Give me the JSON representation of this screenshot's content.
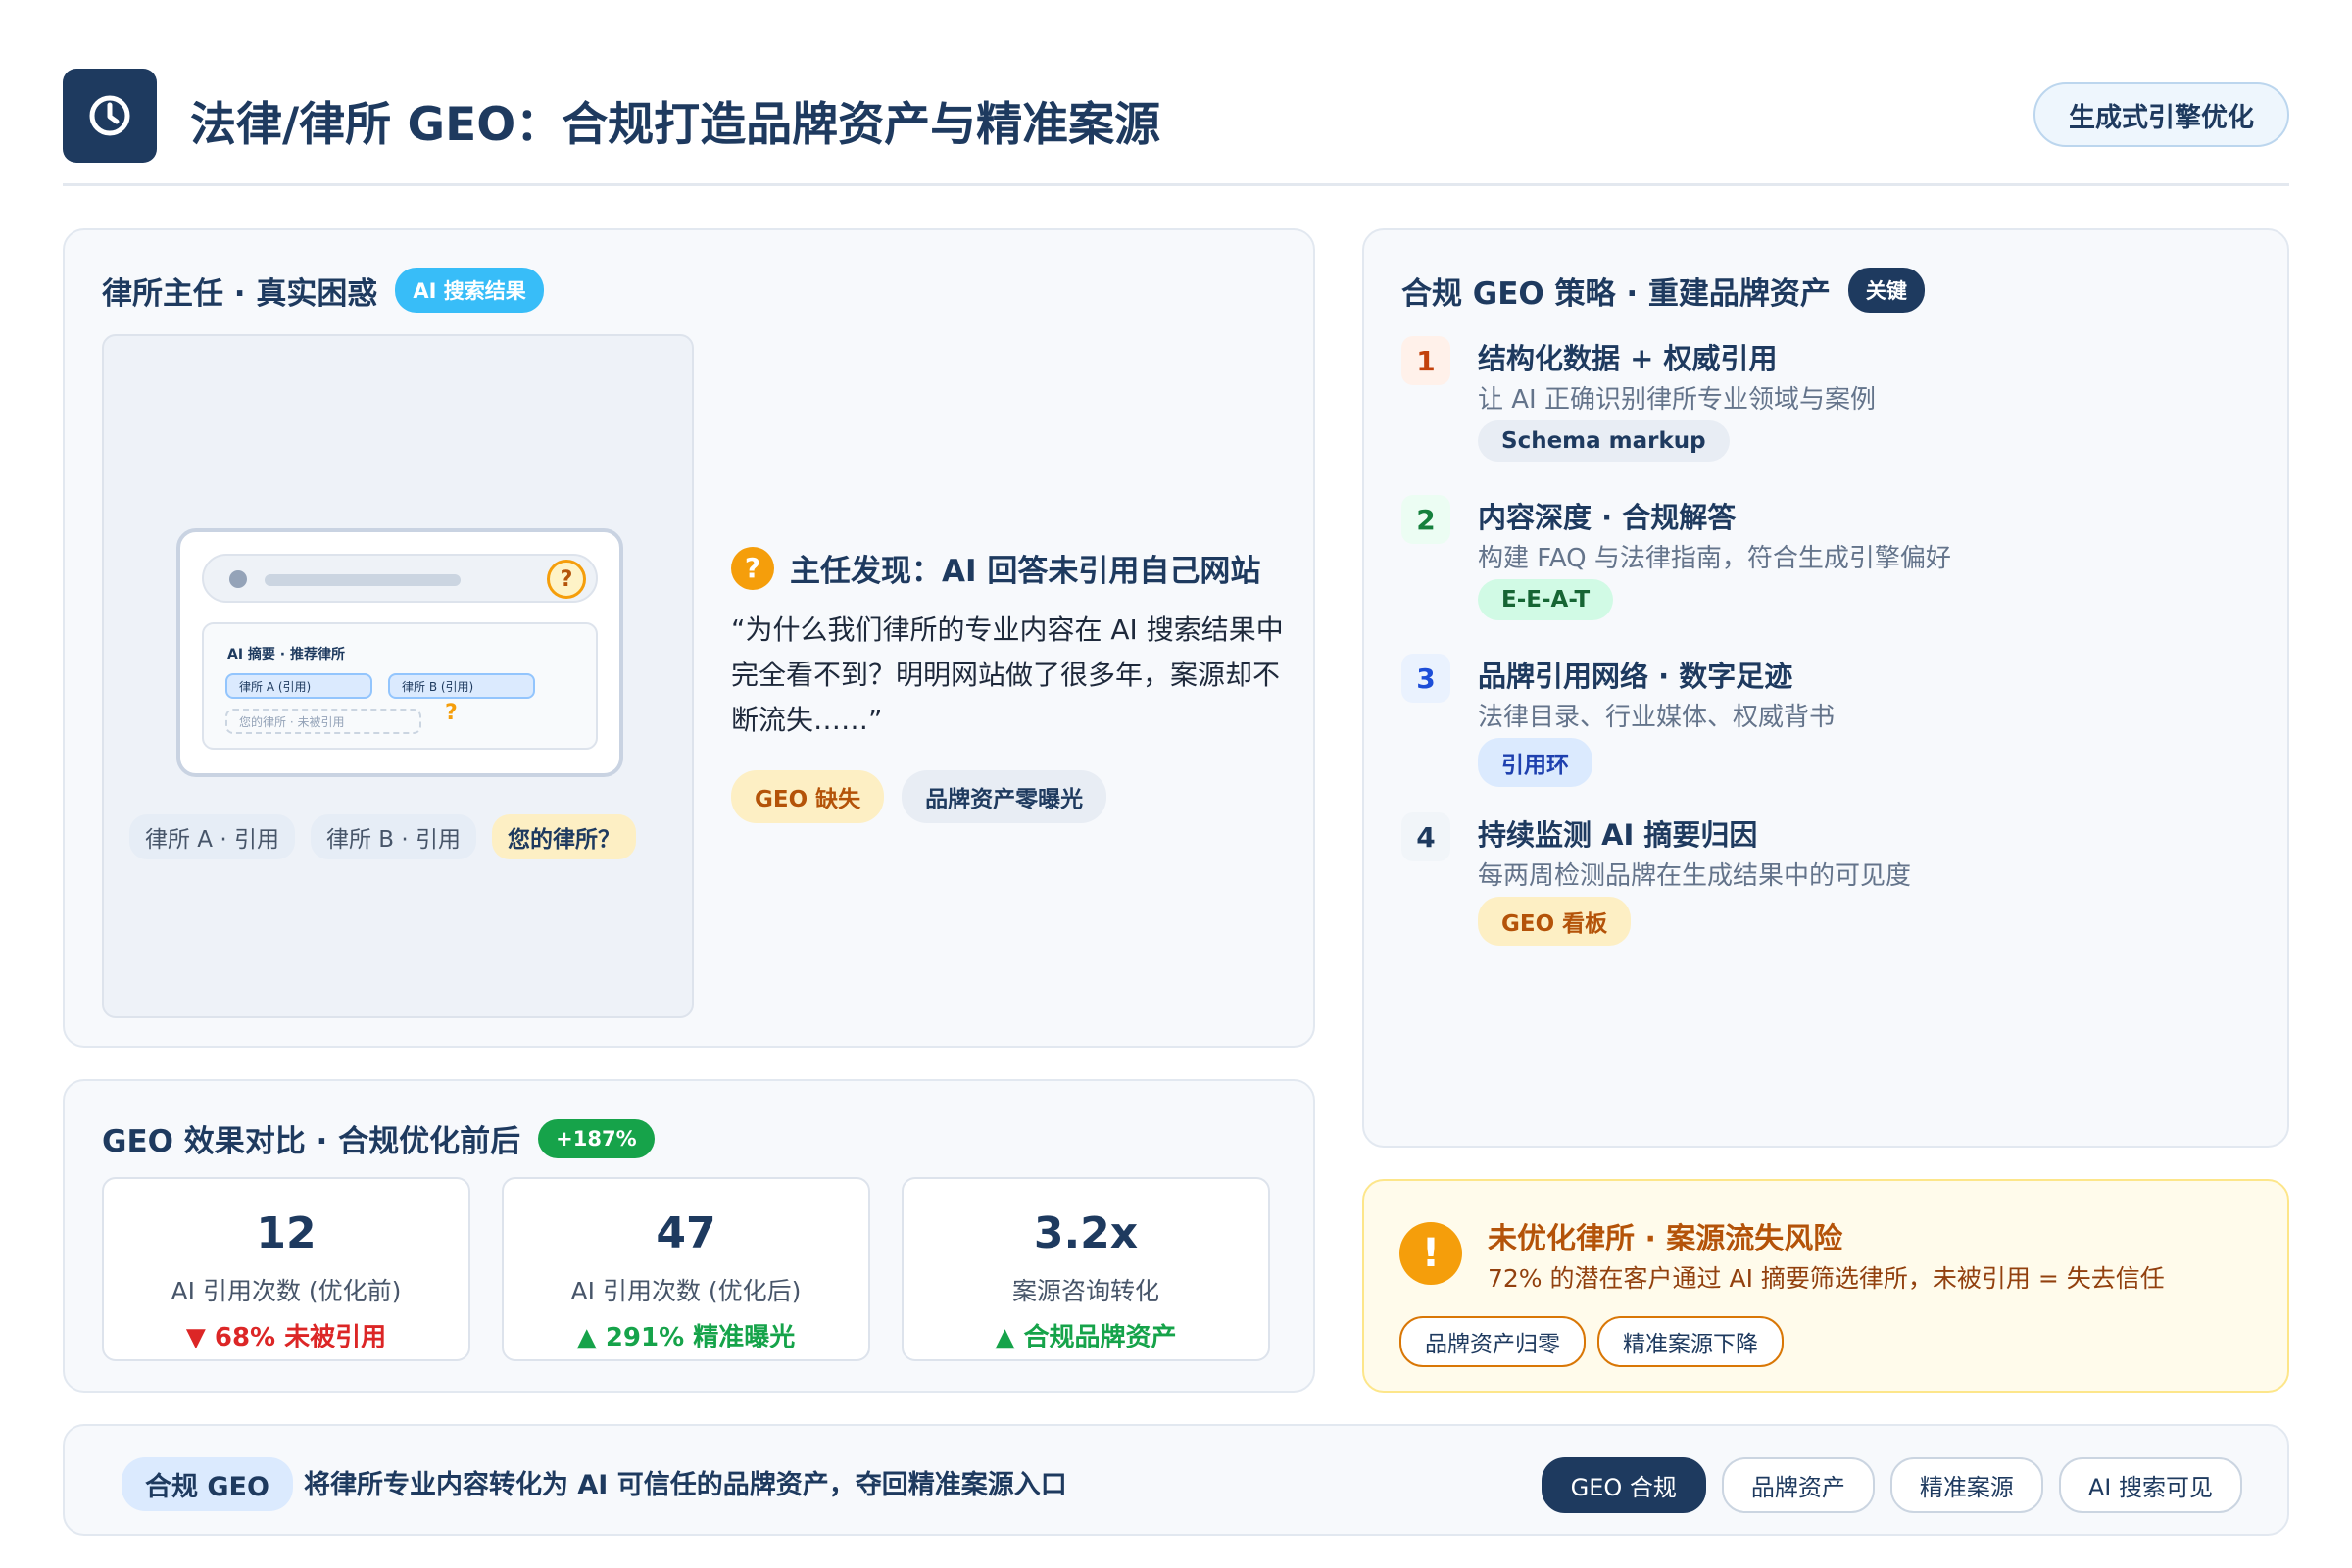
{
  "header": {
    "title": "法律/律所 GEO：合规打造品牌资产与精准案源",
    "pill": "生成式引擎优化",
    "logo_icon": "clock-icon"
  },
  "pain_card": {
    "title": "律所主任 · 真实困惑",
    "tag": "AI 搜索结果",
    "illustration": {
      "ai_box_title": "AI 摘要 · 推荐律所",
      "pill_a": "律所 A (引用)",
      "pill_b": "律所 B (引用)",
      "dashed": "您的律所 · 未被引用",
      "q_mark": "?",
      "search_q": "?",
      "chips": [
        "律所 A · 引用",
        "律所 B · 引用",
        "您的律所？"
      ]
    },
    "finding_icon": "?",
    "finding_title": "主任发现：AI 回答未引用自己网站",
    "quote": "“为什么我们律所的专业内容在 AI 搜索结果中完全看不到？明明网站做了很多年，案源却不断流失……”",
    "tags": [
      "GEO 缺失",
      "品牌资产零曝光"
    ]
  },
  "strategy_card": {
    "title": "合规 GEO 策略 · 重建品牌资产",
    "tag": "关键",
    "steps": [
      {
        "num": "1",
        "title": "结构化数据 + 权威引用",
        "desc": "让 AI 正确识别律所专业领域与案例",
        "badge": "Schema markup"
      },
      {
        "num": "2",
        "title": "内容深度 · 合规解答",
        "desc": "构建 FAQ 与法律指南，符合生成引擎偏好",
        "badge": "E-E-A-T"
      },
      {
        "num": "3",
        "title": "品牌引用网络 · 数字足迹",
        "desc": "法律目录、行业媒体、权威背书",
        "badge": "引用环"
      },
      {
        "num": "4",
        "title": "持续监测 AI 摘要归因",
        "desc": "每两周检测品牌在生成结果中的可见度",
        "badge": "GEO 看板"
      }
    ]
  },
  "effect_card": {
    "title": "GEO 效果对比 · 合规优化前后",
    "tag": "+187%",
    "metrics": [
      {
        "value": "12",
        "label": "AI 引用次数 (优化前)",
        "change": "▼ 68% 未被引用"
      },
      {
        "value": "47",
        "label": "AI 引用次数 (优化后)",
        "change": "▲ 291% 精准曝光"
      },
      {
        "value": "3.2x",
        "label": "案源咨询转化",
        "change": "▲ 合规品牌资产"
      }
    ]
  },
  "risk_card": {
    "icon": "!",
    "title": "未优化律所 · 案源流失风险",
    "desc": "72% 的潜在客户通过 AI 摘要筛选律所，未被引用 = 失去信任",
    "tags": [
      "品牌资产归零",
      "精准案源下降"
    ]
  },
  "footer": {
    "badge": "合规 GEO",
    "text": "将律所专业内容转化为 AI 可信任的品牌资产，夺回精准案源入口",
    "tags": [
      "GEO 合规",
      "品牌资产",
      "精准案源",
      "AI 搜索可见"
    ]
  },
  "colors": {
    "navy": "#1e3a5f",
    "amber": "#f59e0b",
    "red": "#dc2626",
    "green": "#16a34a",
    "sky": "#38bdf8"
  }
}
